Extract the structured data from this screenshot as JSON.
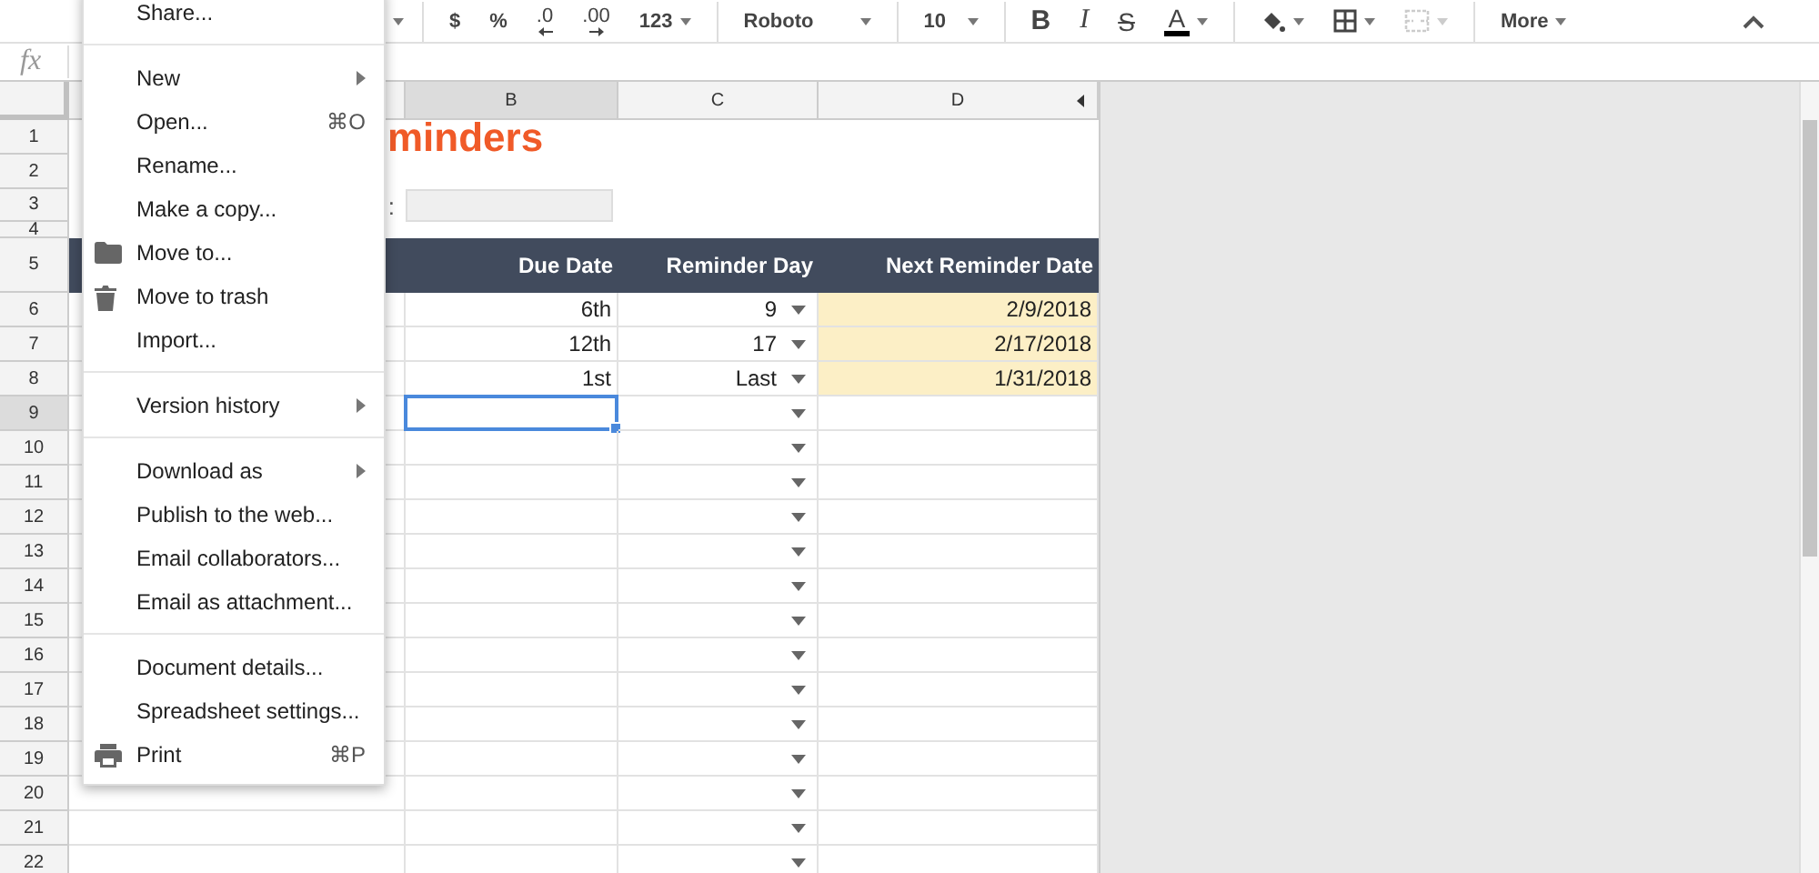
{
  "toolbar": {
    "groups": [
      [
        {
          "kind": "caret",
          "dropdown": true,
          "disabled": false
        }
      ],
      [
        {
          "kind": "currency",
          "label": "$",
          "dropdown": false,
          "disabled": false
        },
        {
          "kind": "percent",
          "label": "%",
          "dropdown": false,
          "disabled": false
        },
        {
          "kind": "dec-decrease",
          "label": ".0",
          "dropdown": false,
          "disabled": false
        },
        {
          "kind": "dec-increase",
          "label": ".00",
          "dropdown": false,
          "disabled": false
        },
        {
          "kind": "number-format",
          "label": "123",
          "dropdown": true,
          "disabled": false
        }
      ],
      [
        {
          "kind": "font",
          "label": "Roboto",
          "dropdown": true,
          "disabled": false
        }
      ],
      [
        {
          "kind": "size",
          "label": "10",
          "dropdown": true,
          "disabled": false
        }
      ],
      [
        {
          "kind": "bold",
          "label": "B",
          "dropdown": false,
          "disabled": false
        },
        {
          "kind": "italic",
          "label": "I",
          "dropdown": false,
          "disabled": false
        },
        {
          "kind": "strike",
          "label": "S",
          "dropdown": false,
          "disabled": false
        },
        {
          "kind": "text-color",
          "label": "A",
          "dropdown": true,
          "disabled": false
        }
      ],
      [
        {
          "kind": "fill",
          "dropdown": true,
          "disabled": false
        },
        {
          "kind": "borders",
          "dropdown": true,
          "disabled": false
        },
        {
          "kind": "merge",
          "dropdown": true,
          "disabled": true
        }
      ],
      [
        {
          "kind": "more",
          "label": "More",
          "dropdown": true,
          "disabled": false
        }
      ]
    ]
  },
  "formula_bar": {
    "label": "fx"
  },
  "sheet": {
    "columns": [
      {
        "label": "B",
        "selected": true
      },
      {
        "label": "C",
        "selected": false
      },
      {
        "label": "D",
        "selected": false
      }
    ],
    "rows": [
      {
        "number": "1",
        "kind": "title",
        "selected": false,
        "title": "minders"
      },
      {
        "number": "2",
        "kind": "blank",
        "selected": false
      },
      {
        "number": "3",
        "kind": "field",
        "selected": false,
        "label": ":"
      },
      {
        "number": "4",
        "kind": "spacer",
        "selected": false
      },
      {
        "number": "5",
        "kind": "header",
        "selected": false,
        "headers": [
          "Due Date",
          "Reminder Day",
          "Next Reminder Date"
        ]
      },
      {
        "number": "6",
        "kind": "data",
        "selected": false,
        "due": "6th",
        "day": "9",
        "next": "2/9/2018"
      },
      {
        "number": "7",
        "kind": "data",
        "selected": false,
        "due": "12th",
        "day": "17",
        "next": "2/17/2018"
      },
      {
        "number": "8",
        "kind": "data",
        "selected": false,
        "due": "1st",
        "day": "Last",
        "next": "1/31/2018"
      },
      {
        "number": "9",
        "kind": "empty",
        "selected": true
      },
      {
        "number": "10",
        "kind": "empty",
        "selected": false
      },
      {
        "number": "11",
        "kind": "empty",
        "selected": false
      },
      {
        "number": "12",
        "kind": "empty",
        "selected": false
      },
      {
        "number": "13",
        "kind": "empty",
        "selected": false
      },
      {
        "number": "14",
        "kind": "empty",
        "selected": false
      },
      {
        "number": "15",
        "kind": "empty",
        "selected": false
      },
      {
        "number": "16",
        "kind": "empty",
        "selected": false
      },
      {
        "number": "17",
        "kind": "empty",
        "selected": false
      },
      {
        "number": "18",
        "kind": "empty",
        "selected": false
      },
      {
        "number": "19",
        "kind": "empty",
        "selected": false
      },
      {
        "number": "20",
        "kind": "empty",
        "selected": false
      },
      {
        "number": "21",
        "kind": "empty",
        "selected": false
      },
      {
        "number": "22",
        "kind": "empty",
        "selected": false
      }
    ]
  },
  "menu": {
    "items": [
      {
        "kind": "plain",
        "label": "Share...",
        "submenu": false
      },
      {
        "kind": "divider"
      },
      {
        "kind": "plain",
        "label": "New",
        "submenu": true
      },
      {
        "kind": "plain",
        "label": "Open...",
        "shortcut": "⌘O",
        "submenu": false
      },
      {
        "kind": "plain",
        "label": "Rename...",
        "submenu": false
      },
      {
        "kind": "plain",
        "label": "Make a copy...",
        "submenu": false
      },
      {
        "kind": "folder",
        "label": "Move to...",
        "submenu": false
      },
      {
        "kind": "trash",
        "label": "Move to trash",
        "submenu": false
      },
      {
        "kind": "plain",
        "label": "Import...",
        "submenu": false
      },
      {
        "kind": "divider"
      },
      {
        "kind": "plain",
        "label": "Version history",
        "submenu": true
      },
      {
        "kind": "divider"
      },
      {
        "kind": "plain",
        "label": "Download as",
        "submenu": true
      },
      {
        "kind": "plain",
        "label": "Publish to the web...",
        "submenu": false
      },
      {
        "kind": "plain",
        "label": "Email collaborators...",
        "submenu": false
      },
      {
        "kind": "plain",
        "label": "Email as attachment...",
        "submenu": false
      },
      {
        "kind": "divider"
      },
      {
        "kind": "plain",
        "label": "Document details...",
        "submenu": false
      },
      {
        "kind": "plain",
        "label": "Spreadsheet settings...",
        "submenu": false
      },
      {
        "kind": "print",
        "label": "Print",
        "shortcut": "⌘P",
        "submenu": false
      }
    ]
  }
}
